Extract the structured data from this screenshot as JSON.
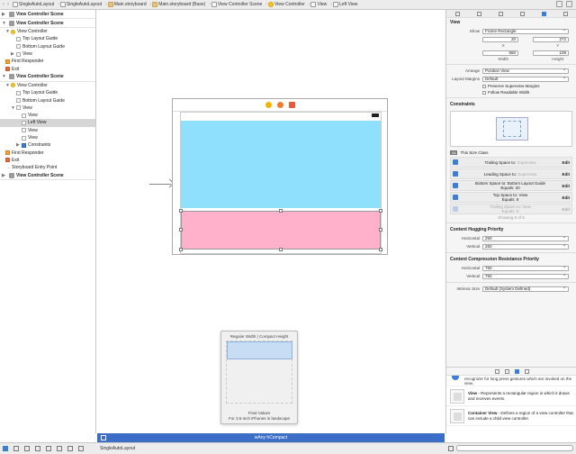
{
  "breadcrumb": [
    "SingleAutoLayout",
    "SingleAutoLayout",
    "Main.storyboard",
    "Main.storyboard (Base)",
    "View Controller Scene",
    "View Controller",
    "View",
    "Left View"
  ],
  "outline": {
    "scene1": {
      "title": "View Controller Scene"
    },
    "scene2": {
      "title": "View Controller Scene",
      "items": [
        "View Controller",
        "Top Layout Guide",
        "Bottom Layout Guide",
        "View",
        "First Responder",
        "Exit"
      ]
    },
    "scene3": {
      "title": "View Controller Scene",
      "items": [
        "View Controller",
        "Top Layout Guide",
        "Bottom Layout Guide",
        "View",
        "View",
        "Left View",
        "View",
        "View",
        "Constraints",
        "First Responder",
        "Exit",
        "Storyboard Entry Point"
      ]
    },
    "scene4": {
      "title": "View Controller Scene"
    }
  },
  "popover": {
    "title": "Regular Width | Compact Height",
    "final_values": "Final Values",
    "device": "For 3.5-inch iPhones in landscape"
  },
  "size_class_bar": "wAny hCompact",
  "project_name": "SingleAutoLayout",
  "inspector": {
    "section_view": "View",
    "show_label": "Show",
    "show_value": "Frame Rectangle",
    "x": "20",
    "y": "272",
    "x_label": "X",
    "y_label": "Y",
    "width": "560",
    "height": "108",
    "width_label": "Width",
    "height_label": "Height",
    "arrange_label": "Arrange",
    "arrange_value": "Position View",
    "margins_label": "Layout Margins",
    "margins_value": "Default",
    "preserve_label": "Preserve Superview Margins",
    "follow_label": "Follow Readable Width",
    "constraints_heading": "Constraints",
    "all_tag": "All",
    "size_class_text": "This Size Class",
    "constraints": [
      {
        "l1": "Trailing Space to: ",
        "g1": "Superview",
        "l2": "",
        "edit": "Edit"
      },
      {
        "l1": "Leading Space to: ",
        "g1": "Superview",
        "l2": "",
        "edit": "Edit"
      },
      {
        "l1": "Bottom Space to: Bottom Layout Guide",
        "g1": "",
        "l2": "Equals: 20",
        "edit": "Edit"
      },
      {
        "l1": "Top Space to: View",
        "g1": "",
        "l2": "Equals: 8",
        "edit": "Edit"
      },
      {
        "l1": "Trailing Space to: View",
        "g1": "",
        "l2": "Equals: 8",
        "edit": "Edit"
      }
    ],
    "showing": "Showing 5 of 6",
    "hugging_heading": "Content Hugging Priority",
    "horizontal_label": "Horizontal",
    "vertical_label": "Vertical",
    "hug_h": "250",
    "hug_v": "250",
    "compression_heading": "Content Compression Resistance Priority",
    "comp_h": "750",
    "comp_v": "750",
    "intrinsic_label": "Intrinsic Size",
    "intrinsic_value": "Default (System Defined)"
  },
  "library": {
    "first_desc": "recognizer for long press gestures which are invoked on the view.",
    "items": [
      {
        "name": "View",
        "desc": " - Represents a rectangular region in which it draws and receives events."
      },
      {
        "name": "Container View",
        "desc": " - Defines a region of a view controller that can include a child view controller."
      }
    ]
  },
  "colors": {
    "accent": "#3d6ec7",
    "blue_view": "#8fe0fd",
    "pink_view": "#ffb1cb"
  }
}
